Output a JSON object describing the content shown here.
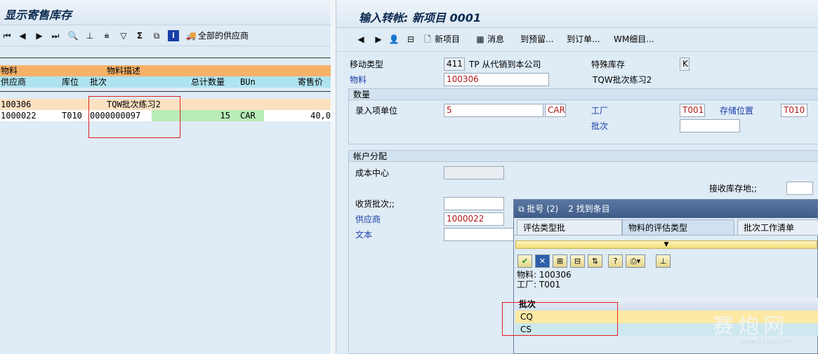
{
  "left": {
    "title": "显示寄售库存",
    "toolbar": {
      "icons": [
        "first-page-icon",
        "prev-page-icon",
        "next-page-icon",
        "last-page-icon",
        "find-icon",
        "print-icon",
        "filter-icon",
        "sort-icon",
        "sum-icon",
        "subtotal-icon",
        "info-icon",
        "truck-icon"
      ],
      "all_vendors_label": "全部的供应商"
    },
    "header1": {
      "material": "物料",
      "material_desc": "物料描述"
    },
    "header2": {
      "vendor": "供应商",
      "storage_loc": "库位",
      "batch": "批次",
      "total_qty": "总计数量",
      "bun": "BUn",
      "consign_price": "寄售价"
    },
    "rows": [
      {
        "material": "100306",
        "desc": "TQW批次练习2"
      },
      {
        "vendor": "1000022",
        "storage_loc": "T010",
        "batch": "0000000097",
        "qty": "15",
        "bun": "CAR",
        "price": "40,0"
      }
    ]
  },
  "right": {
    "title": "输入转帐: 新项目 0001",
    "toolbar": {
      "new_item": "新项目",
      "message": "消息",
      "to_reservation": "到预留...",
      "to_order": "到订单...",
      "wm_detail": "WM细目..."
    },
    "movement_type": {
      "label": "移动类型",
      "value": "411",
      "desc": "TP 从代销到本公司"
    },
    "special_stock": {
      "label": "特殊库存",
      "value": "K"
    },
    "material": {
      "label": "物料",
      "value": "100306",
      "desc": "TQW批次练习2"
    },
    "qty_group": {
      "title": "数量",
      "entry_unit_label": "录入项单位",
      "qty": "5",
      "unit": "CAR",
      "plant_label": "工厂",
      "plant": "T001",
      "sloc_label": "存储位置",
      "sloc": "T010",
      "batch_label": "批次",
      "batch": ""
    },
    "acct_group": {
      "title": "帐户分配",
      "cost_center_label": "成本中心",
      "recv_sloc_label": "接收库存地;;",
      "recv_batch_label": "收货批次;;",
      "vendor_label": "供应商",
      "vendor": "1000022",
      "text_label": "文本"
    }
  },
  "popup": {
    "title": "批号 (2)",
    "found": "2 找到条目",
    "tabs": [
      "评估类型批",
      "物料的评估类型",
      "批次工作清单"
    ],
    "info_material": "物料: 100306",
    "info_plant": "工厂: T001",
    "col_header": "批次",
    "batches": [
      "CQ",
      "CS"
    ]
  },
  "watermark": {
    "text": "赛炮网",
    "url": "www.91sap.com"
  },
  "colors": {
    "orange_header": "#f7b26a",
    "cyan_header": "#aee3f0",
    "green_cell": "#b8ecb8",
    "highlight_row": "#fde9a3",
    "red_box": "#e02020"
  }
}
